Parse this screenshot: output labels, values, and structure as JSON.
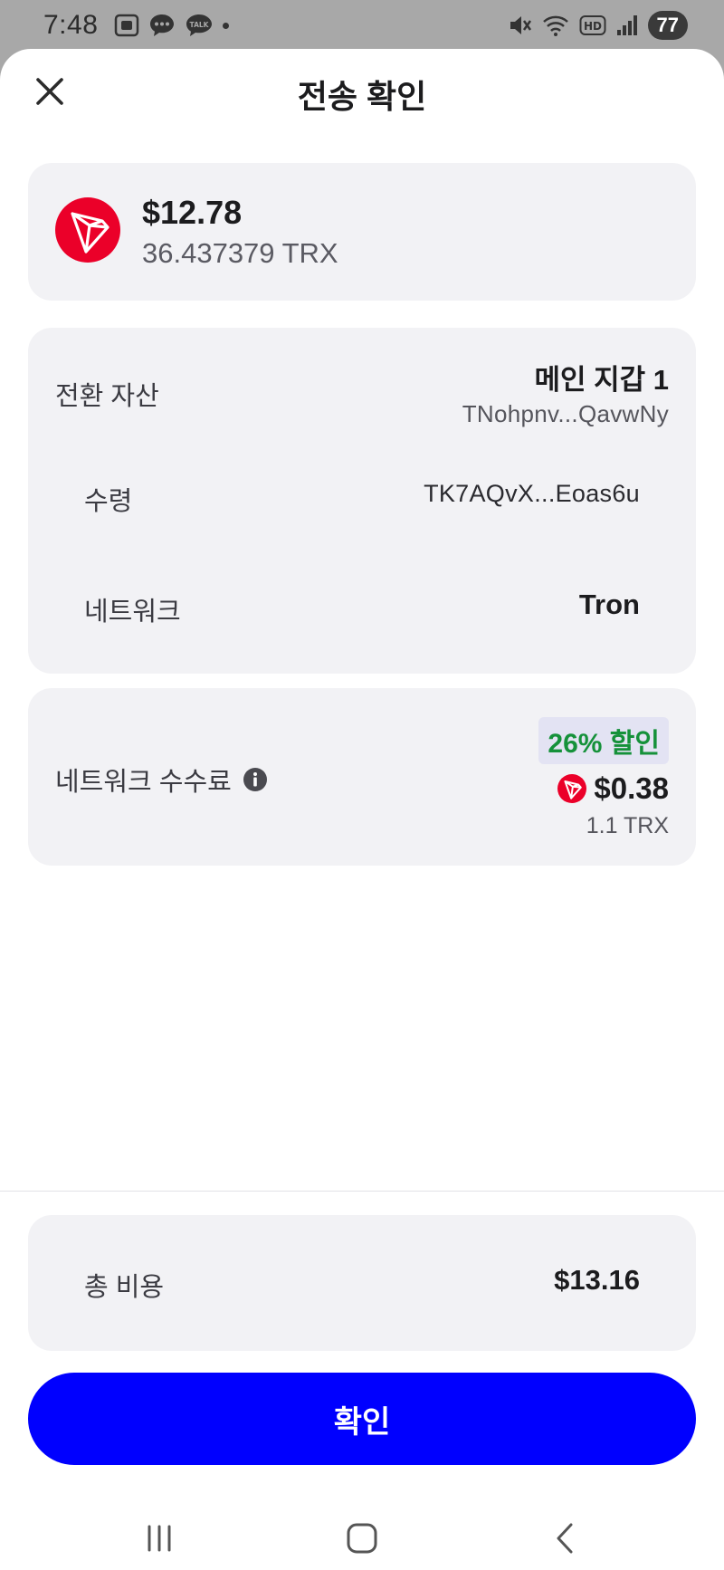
{
  "status_bar": {
    "time": "7:48",
    "battery": "77",
    "left_icons": [
      "screenshot-icon",
      "chat-bubble-icon",
      "kakaotalk-icon",
      "notification-dot-icon"
    ],
    "right_icons": [
      "mute-icon",
      "wifi-icon",
      "hd-icon",
      "signal-icon"
    ]
  },
  "header": {
    "title": "전송 확인"
  },
  "amount": {
    "usd": "$12.78",
    "trx": "36.437379 TRX",
    "token_icon": "tron-icon",
    "token_color": "#eb0029"
  },
  "details": {
    "asset_label": "전환 자산",
    "wallet_name": "메인 지갑 1",
    "wallet_address": "TNohpnv...QavwNy",
    "receive_label": "수령",
    "receive_address": "TK7AQvX...Eoas6u",
    "network_label": "네트워크",
    "network_value": "Tron"
  },
  "fee": {
    "label": "네트워크 수수료",
    "discount_badge": "26% 할인",
    "discount_color": "#15913a",
    "usd": "$0.38",
    "trx": "1.1 TRX"
  },
  "total": {
    "label": "총 비용",
    "value": "$13.16"
  },
  "confirm_button": {
    "label": "확인",
    "color": "#0000ff"
  },
  "nav_bar": {
    "buttons": [
      "recent-apps-icon",
      "home-icon",
      "back-icon"
    ]
  }
}
